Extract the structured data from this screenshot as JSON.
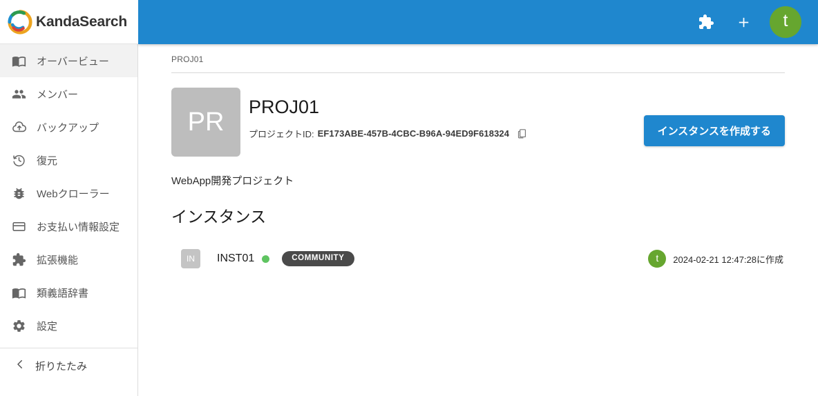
{
  "brand": {
    "name": "KandaSearch",
    "logo_icon": "kandasearch-swirl-logo",
    "colors": {
      "header_blue": "#1f87ce",
      "avatar_green": "#66a62f",
      "status_green": "#5fc461",
      "badge_dark": "#4a4a4a",
      "thumb_gray": "#bdbdbd"
    }
  },
  "header": {
    "extensions_icon": "puzzle-piece-icon",
    "add_icon": "plus-icon",
    "avatar_initial": "t"
  },
  "sidebar": {
    "items": [
      {
        "label": "オーバービュー",
        "icon": "book-icon",
        "active": true
      },
      {
        "label": "メンバー",
        "icon": "people-icon",
        "active": false
      },
      {
        "label": "バックアップ",
        "icon": "cloud-upload-icon",
        "active": false
      },
      {
        "label": "復元",
        "icon": "history-restore-icon",
        "active": false
      },
      {
        "label": "Webクローラー",
        "icon": "bug-icon",
        "active": false
      },
      {
        "label": "お支払い情報設定",
        "icon": "credit-card-icon",
        "active": false
      },
      {
        "label": "拡張機能",
        "icon": "puzzle-piece-icon",
        "active": false
      },
      {
        "label": "類義語辞書",
        "icon": "book-icon",
        "active": false
      },
      {
        "label": "設定",
        "icon": "gear-icon",
        "active": false
      }
    ],
    "collapse": {
      "label": "折りたたみ",
      "icon": "chevron-left-icon"
    }
  },
  "main": {
    "breadcrumb": "PROJ01",
    "project": {
      "thumb_initials": "PR",
      "title": "PROJ01",
      "id_label": "プロジェクトID:",
      "id_value": "EF173ABE-457B-4CBC-B96A-94ED9F618324",
      "copy_icon": "clipboard-copy-icon",
      "description": "WebApp開発プロジェクト"
    },
    "create_instance_button": "インスタンスを作成する",
    "section_title": "インスタンス",
    "instances": [
      {
        "thumb_initials": "IN",
        "name": "INST01",
        "status": "running",
        "edition": "COMMUNITY",
        "owner_initial": "t",
        "created": "2024-02-21 12:47:28に作成"
      }
    ]
  }
}
